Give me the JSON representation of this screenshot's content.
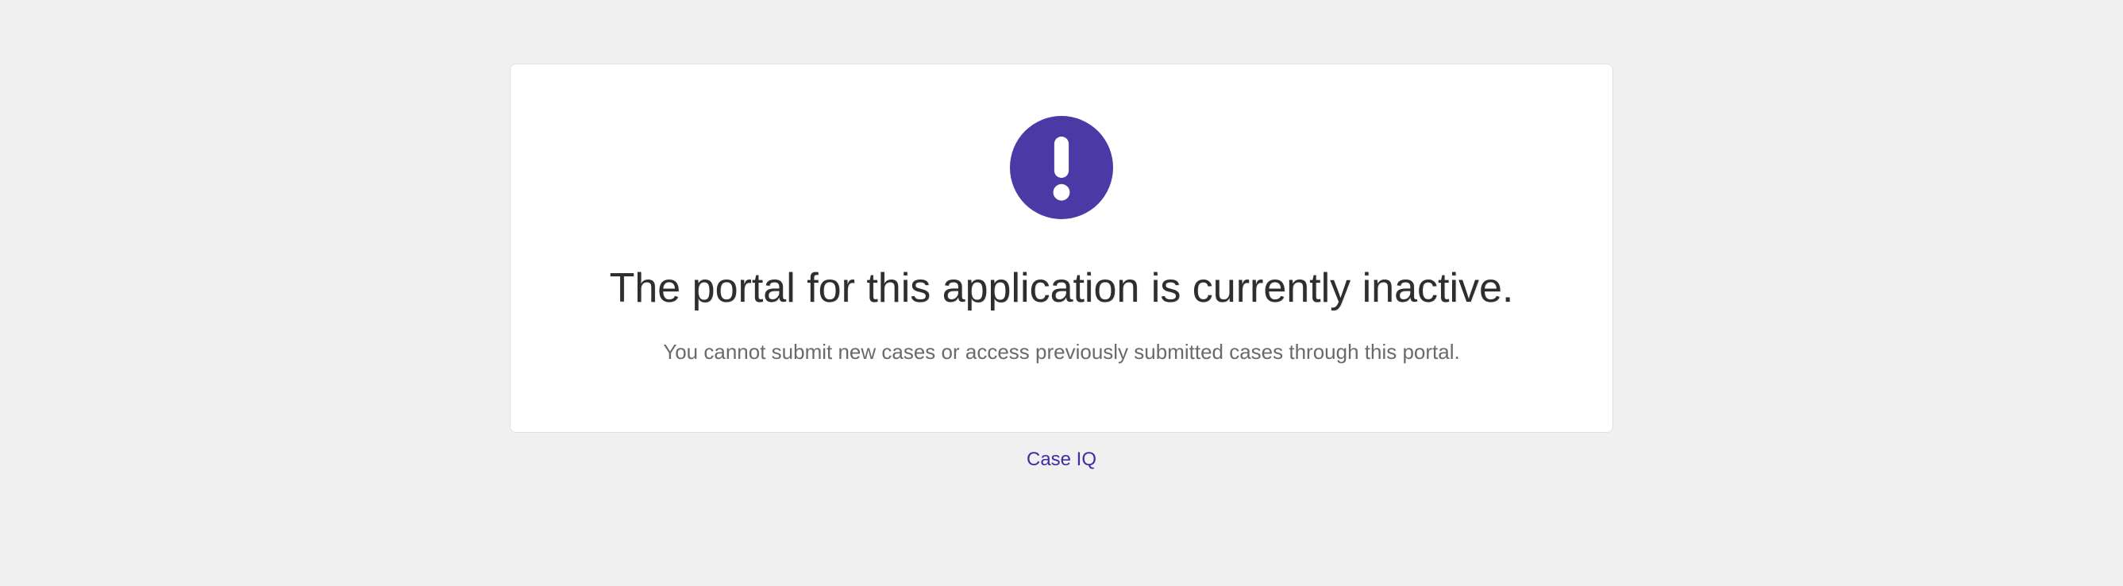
{
  "card": {
    "icon_name": "exclamation-circle-icon",
    "icon_color": "#4b3aa5",
    "heading": "The portal for this application is currently inactive.",
    "subtext": "You cannot submit new cases or access previously submitted cases through this portal."
  },
  "footer": {
    "link_label": "Case IQ"
  }
}
